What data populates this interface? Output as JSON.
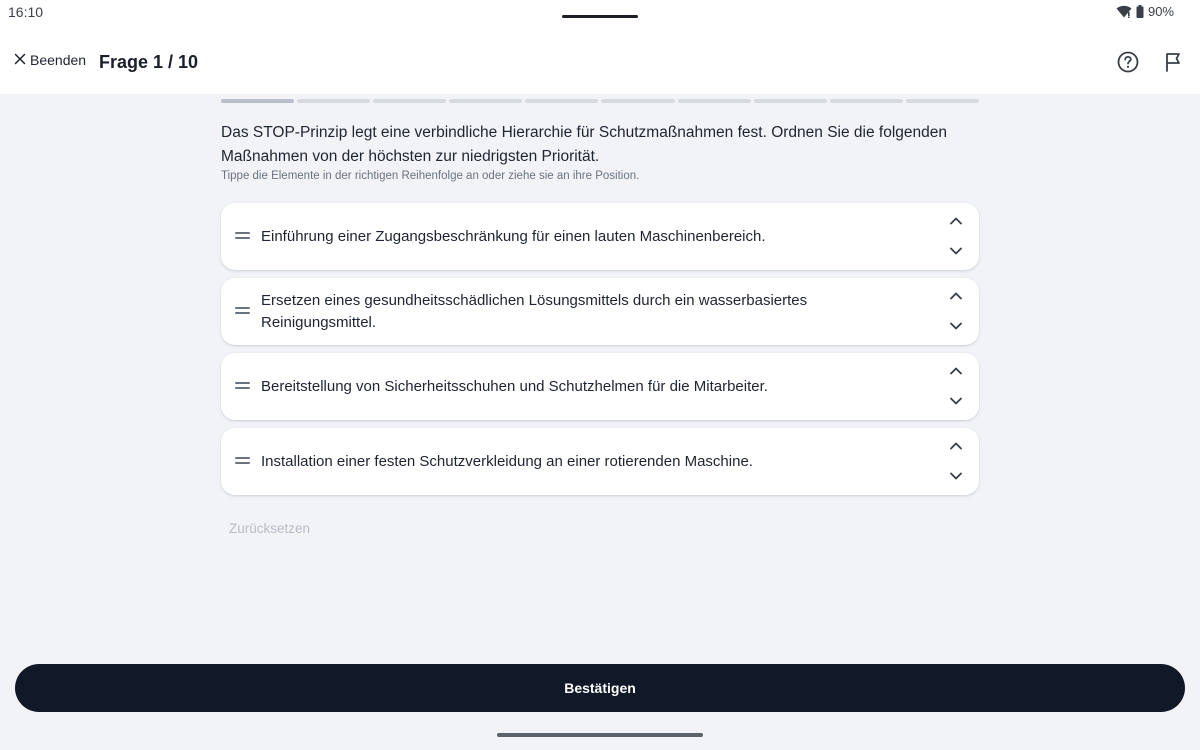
{
  "status_bar": {
    "time": "16:10",
    "battery": "90%"
  },
  "header": {
    "quit_label": "Beenden",
    "title": "Frage 1 / 10"
  },
  "progress": {
    "current": 1,
    "total": 10
  },
  "question": {
    "text": "Das STOP-Prinzip legt eine verbindliche Hierarchie für Schutzmaßnahmen fest. Ordnen Sie die folgenden Maßnahmen von der höchsten zur niedrigsten Priorität.",
    "hint": "Tippe die Elemente in der richtigen Reihenfolge an oder ziehe sie an ihre Position."
  },
  "items": [
    {
      "label": "Einführung einer Zugangsbeschränkung für einen lauten Maschinenbereich."
    },
    {
      "label": "Ersetzen eines gesundheitsschädlichen Lösungsmittels durch ein wasserbasiertes Reinigungsmittel."
    },
    {
      "label": "Bereitstellung von Sicherheitsschuhen und Schutzhelmen für die Mitarbeiter."
    },
    {
      "label": "Installation einer festen Schutzverkleidung an einer rotierenden Maschine."
    }
  ],
  "reset_label": "Zurücksetzen",
  "confirm_label": "Bestätigen",
  "icons": {
    "close": "close-icon",
    "help": "help-circle-icon",
    "flag": "flag-icon",
    "drag": "drag-handle-icon",
    "up": "chevron-up-icon",
    "down": "chevron-down-icon",
    "wifi": "wifi-icon",
    "battery": "battery-icon"
  },
  "colors": {
    "primary": "#111827",
    "background": "#f1f3f7",
    "card": "#ffffff",
    "reset_text": "#b8bcc4"
  }
}
